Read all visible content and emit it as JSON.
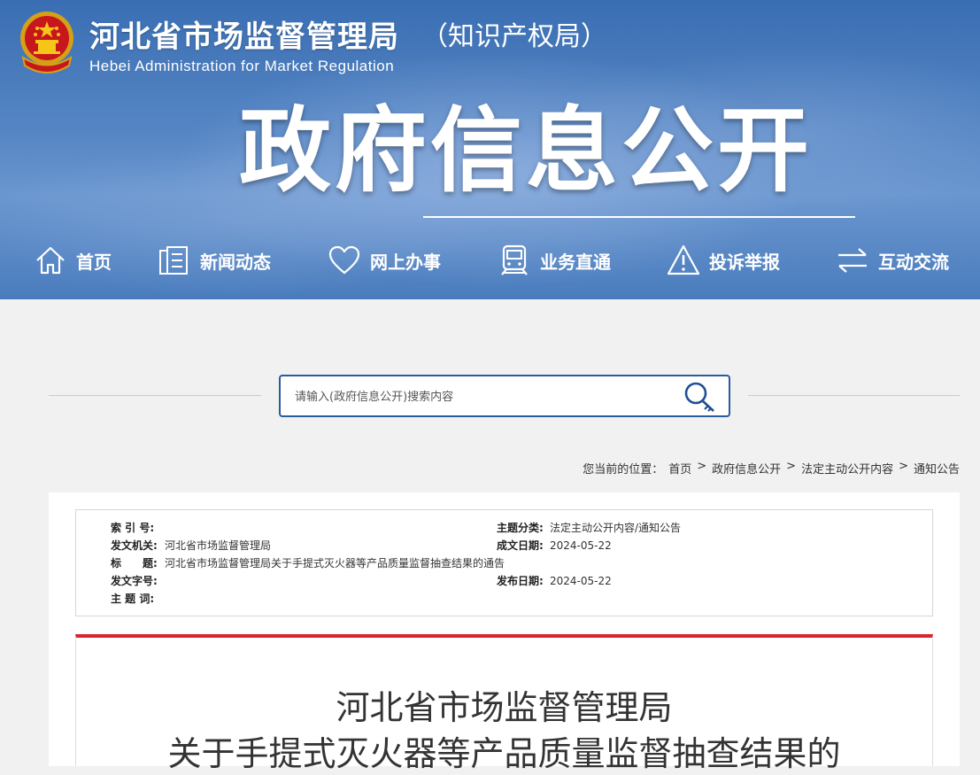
{
  "header": {
    "site_title": "河北省市场监督管理局",
    "site_subtitle": "（知识产权局）",
    "site_english": "Hebei Administration for Market Regulation",
    "banner_title": "政府信息公开"
  },
  "nav": {
    "items": [
      {
        "label": "首页",
        "icon": "home-icon"
      },
      {
        "label": "新闻动态",
        "icon": "news-icon"
      },
      {
        "label": "网上办事",
        "icon": "heart-icon"
      },
      {
        "label": "业务直通",
        "icon": "train-icon"
      },
      {
        "label": "投诉举报",
        "icon": "warning-icon"
      },
      {
        "label": "互动交流",
        "icon": "exchange-icon"
      }
    ]
  },
  "search": {
    "placeholder": "请输入(政府信息公开)搜索内容",
    "icon": "search-key-icon"
  },
  "breadcrumb": {
    "prefix": "您当前的位置：",
    "items": [
      "首页",
      "政府信息公开",
      "法定主动公开内容",
      "通知公告"
    ],
    "separator": ">"
  },
  "meta": {
    "index_no_label": "索 引 号:",
    "index_no": "",
    "category_label": "主题分类:",
    "category": "法定主动公开内容/通知公告",
    "issuer_label": "发文机关:",
    "issuer": "河北省市场监督管理局",
    "created_label": "成文日期:",
    "created": "2024-05-22",
    "title_label": "标　　题:",
    "title": "河北省市场监督管理局关于手提式灭火器等产品质量监督抽查结果的通告",
    "doc_no_label": "发文字号:",
    "doc_no": "",
    "published_label": "发布日期:",
    "published": "2024-05-22",
    "keywords_label": "主 题 词:",
    "keywords": ""
  },
  "article": {
    "title_line1": "河北省市场监督管理局",
    "title_line2": "关于手提式灭火器等产品质量监督抽查结果的"
  },
  "colors": {
    "header_blue": "#3a6eb3",
    "accent_red": "#d7262c",
    "search_border": "#2a5aa0"
  }
}
